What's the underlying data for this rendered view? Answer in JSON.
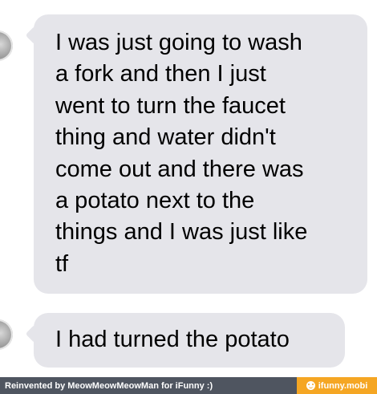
{
  "messages": [
    {
      "sender": "received",
      "text": "I was just going to wash\na fork and then I just\nwent to turn the faucet\nthing and water didn't\ncome out and there was\na potato next to the\nthings and I was just like\ntf"
    },
    {
      "sender": "received",
      "text": "I had turned the potato"
    }
  ],
  "footer": {
    "credit": "Reinvented by MeowMeowMeowMan for iFunny :)",
    "site": "ifunny.mobi",
    "icon": "smile-icon"
  },
  "colors": {
    "bubble": "#e5e5ea",
    "footer_left": "#4f5560",
    "footer_right": "#f5a623"
  }
}
